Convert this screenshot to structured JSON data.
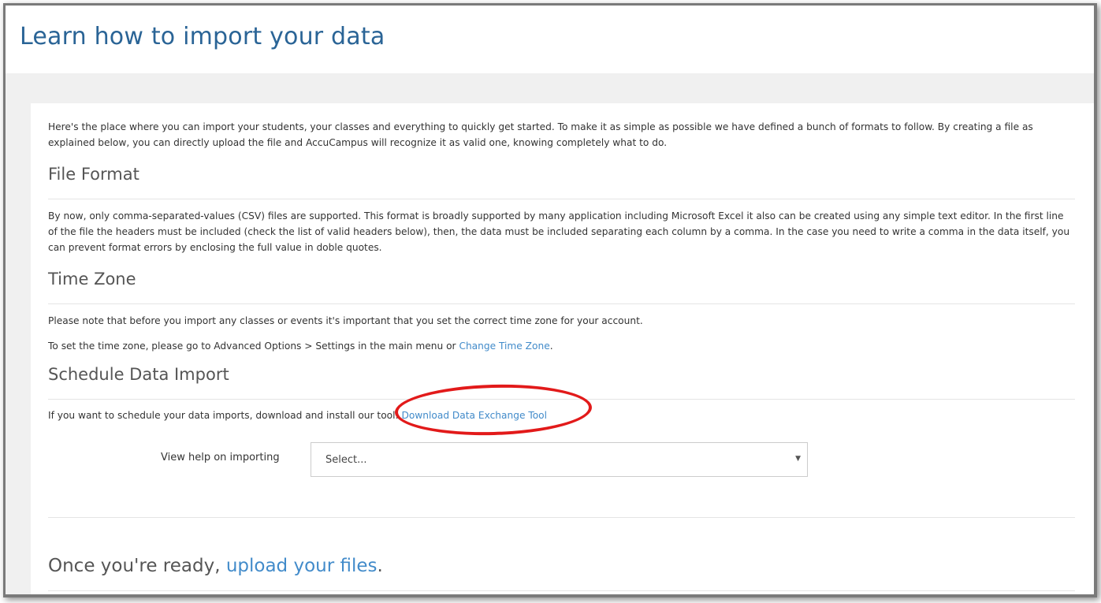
{
  "page": {
    "title": "Learn how to import your data"
  },
  "intro": {
    "text": "Here's the place where you can import your students, your classes and everything to quickly get started. To make it as simple as possible we have defined a bunch of formats to follow. By creating a file as explained below, you can directly upload the file and AccuCampus will recognize it as valid one, knowing completely what to do."
  },
  "file_format": {
    "heading": "File Format",
    "text": "By now, only comma-separated-values (CSV) files are supported. This format is broadly supported by many application including Microsoft Excel it also can be created using any simple text editor. In the first line of the file the headers must be included (check the list of valid headers below), then, the data must be included separating each column by a comma. In the case you need to write a comma in the data itself, you can prevent format errors by enclosing the full value in doble quotes."
  },
  "time_zone": {
    "heading": "Time Zone",
    "note": "Please note that before you import any classes or events it's important that you set the correct time zone for your account.",
    "instruction_prefix": "To set the time zone, please go to Advanced Options > Settings in the main menu or ",
    "link_label": "Change Time Zone",
    "instruction_suffix": "."
  },
  "schedule": {
    "heading": "Schedule Data Import",
    "text_prefix": "If you want to schedule your data imports, download and install our tool: ",
    "link_label": "Download Data Exchange Tool"
  },
  "help_select": {
    "label": "View help on importing",
    "value": "Select...",
    "arrow": "▼"
  },
  "ready": {
    "prefix": "Once you're ready, ",
    "link_label": "upload your files",
    "suffix": "."
  },
  "colors": {
    "link": "#428bca",
    "title": "#2a6496",
    "annotation": "#e21a1a"
  }
}
